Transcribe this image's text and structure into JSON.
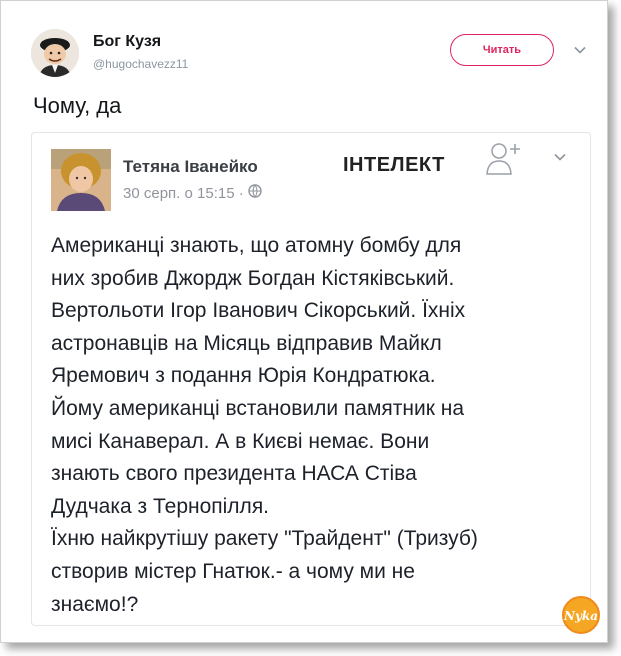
{
  "tweet": {
    "author_name": "Бог Кузя",
    "author_handle": "@hugochavezz11",
    "follow_label": "Читать",
    "text": "Чому, да"
  },
  "fb_post": {
    "author_name": "Тетяна Іванейко",
    "tag": "ІНТЕЛЕКТ",
    "timestamp": "30 серп. о 15:15 ·",
    "body_lines": [
      "Американці знають, що атомну бомбу для",
      "них зробив Джордж Богдан Кістяківський.",
      "Вертольоти Ігор Іванович Сікорський. Їхніх",
      "астронавців на Місяць відправив Майкл",
      "Яремович з подання Юрія Кондратюка.",
      "Йому американці встановили памятник на",
      "мисі Канаверал. А в Києві немає. Вони",
      "знають свого президента НАСА Стіва",
      "Дудчака з Тернопілля.",
      "Їхню найкрутішу ракету \"Трайдент\" (Тризуб)",
      "створив містер Гнатюк.- а чому ми не",
      "знаємо!?"
    ]
  },
  "watermark_text": "Nyka",
  "colors": {
    "follow_accent": "#e0245e",
    "handle_gray": "#8a97a2",
    "fb_meta_gray": "#90949c",
    "watermark_orange": "#f5a623"
  }
}
